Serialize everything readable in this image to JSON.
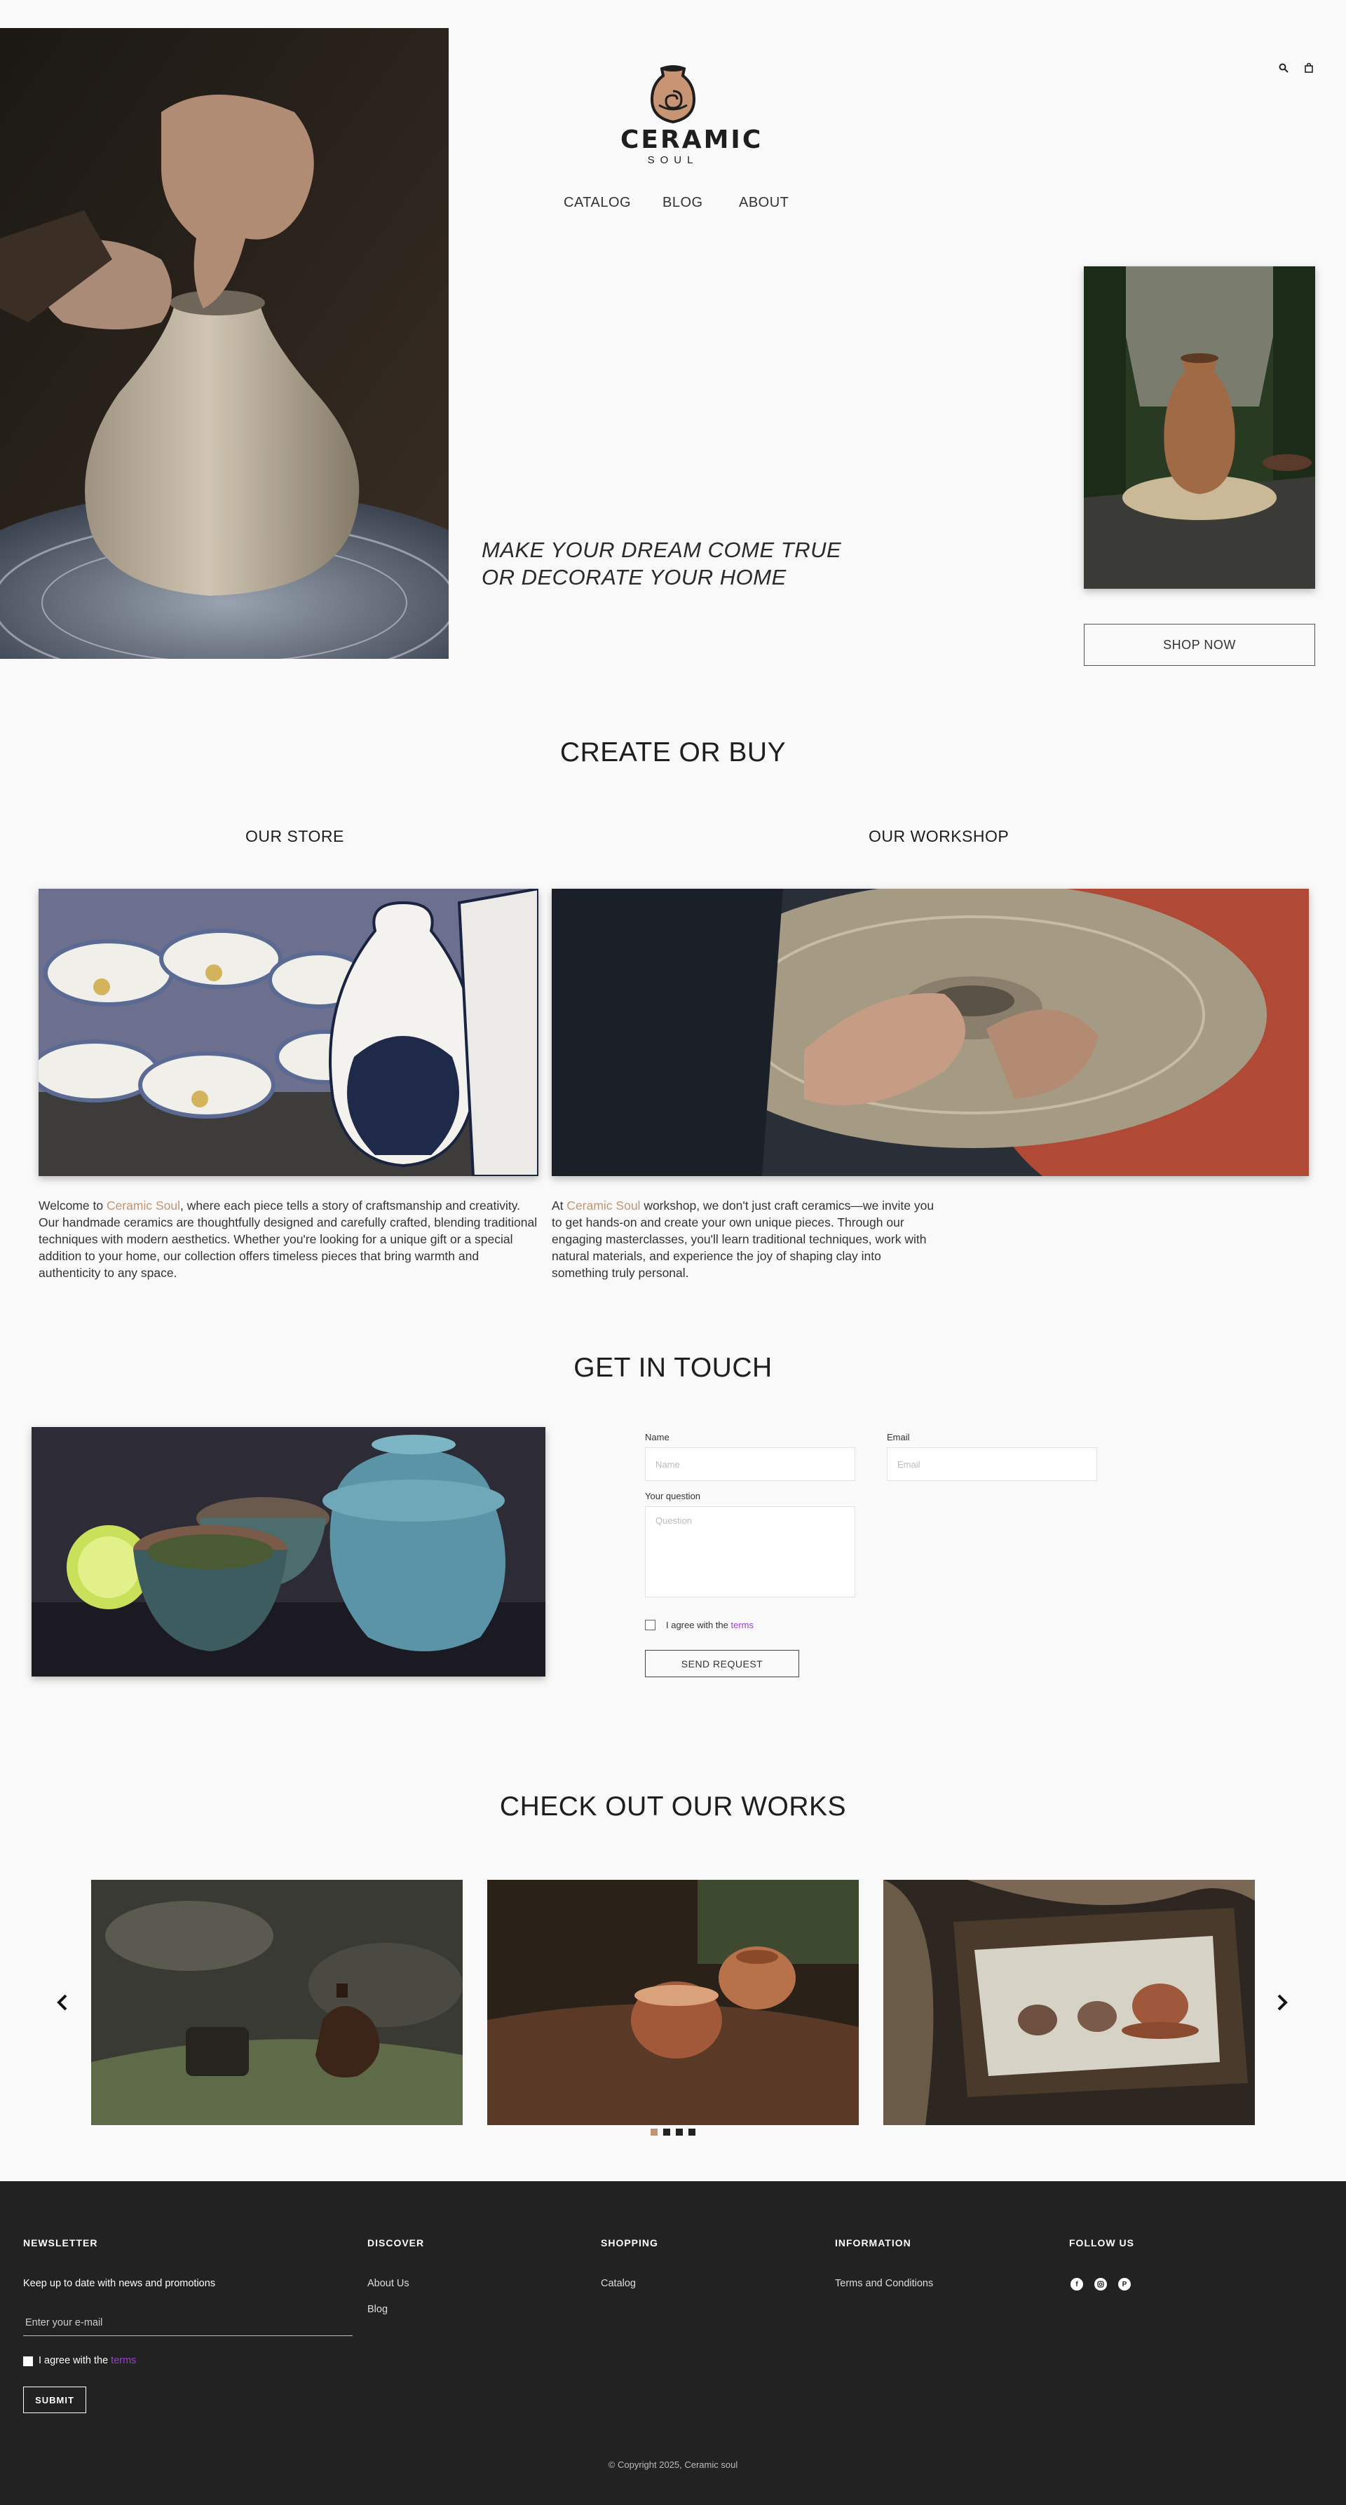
{
  "header": {
    "logo_name": "CERAMIC",
    "logo_sub": "SOUL",
    "nav": [
      "CATALOG",
      "BLOG",
      "ABOUT"
    ]
  },
  "hero": {
    "tagline_line1": "MAKE YOUR DREAM COME TRUE",
    "tagline_line2": "OR DECORATE YOUR HOME",
    "shop_now": "SHOP NOW"
  },
  "create": {
    "title": "CREATE OR BUY",
    "store_title": "OUR STORE",
    "workshop_title": "OUR WORKSHOP",
    "store_text_pre": "Welcome to ",
    "store_text_brand": "Ceramic Soul",
    "store_text_post": ", where each piece tells a story of craftsmanship and creativity. Our handmade ceramics are thoughtfully designed and carefully crafted, blending traditional techniques with modern aesthetics. Whether you're looking for a unique gift or a special addition to your home, our collection offers timeless pieces that bring warmth and authenticity to any space.",
    "workshop_text_pre": "At ",
    "workshop_text_brand": "Ceramic Soul",
    "workshop_text_post": " workshop, we don't just craft ceramics—we invite you to get hands-on and create your own unique pieces. Through our engaging masterclasses, you'll learn traditional techniques, work with natural materials, and experience the joy of shaping clay into something truly personal."
  },
  "contact": {
    "title": "GET IN TOUCH",
    "name_label": "Name",
    "name_placeholder": "Name",
    "email_label": "Email",
    "email_placeholder": "Email",
    "question_label": "Your question",
    "question_placeholder": "Question",
    "agree_text": "I agree with the ",
    "terms": "terms",
    "send": "SEND REQUEST"
  },
  "works": {
    "title": "CHECK OUT OUR WORKS",
    "active_dot": 0
  },
  "footer": {
    "newsletter_title": "NEWSLETTER",
    "newsletter_desc": "Keep up to date with news and promotions",
    "email_placeholder": "Enter your e-mail",
    "agree_text": "I agree with the ",
    "terms": "terms",
    "submit": "SUBMIT",
    "discover_title": "DISCOVER",
    "discover_links": [
      "About Us",
      "Blog"
    ],
    "shopping_title": "SHOPPING",
    "shopping_links": [
      "Catalog"
    ],
    "info_title": "INFORMATION",
    "info_links": [
      "Terms and Conditions"
    ],
    "follow_title": "FOLLOW US",
    "copyright": "© Copyright 2025, Ceramic soul"
  },
  "colors": {
    "accent": "#c29572",
    "link": "#9b3fd0",
    "footer_bg": "#222222"
  }
}
